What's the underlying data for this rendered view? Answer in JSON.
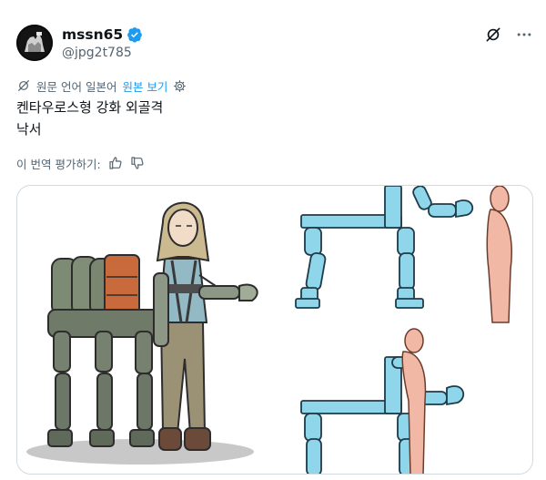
{
  "author": {
    "display_name": "mssn65",
    "handle": "@jpg2t785"
  },
  "translation": {
    "note_prefix": "원문 언어 일본어",
    "note_link": "원본 보기"
  },
  "tweet": {
    "line1": "켄타우로스형 강화 외골격",
    "line2": "낙서"
  },
  "rate": {
    "label": "이 번역 평가하기:"
  },
  "icons": {
    "verified": "verified-badge-icon",
    "grok": "grok-icon",
    "more": "more-dots-icon",
    "translate": "translate-icon",
    "settings": "gear-icon",
    "thumb_up": "thumbs-up-icon",
    "thumb_down": "thumbs-down-icon"
  },
  "colors": {
    "accent": "#1d9bf0",
    "muted": "#536471",
    "text": "#0f1419"
  }
}
